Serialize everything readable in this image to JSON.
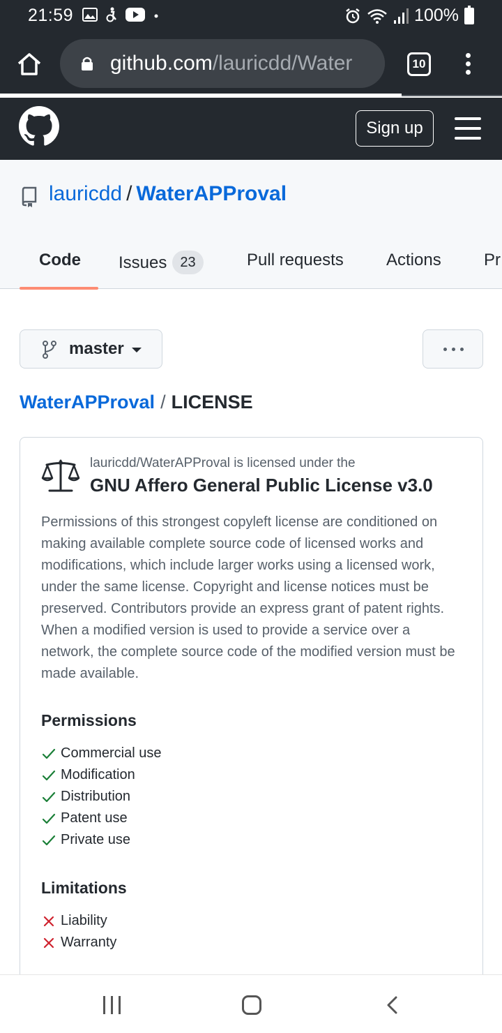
{
  "status_bar": {
    "time": "21:59",
    "battery": "100%",
    "icons": [
      "gallery-icon",
      "accessibility-icon",
      "youtube-icon",
      "dot-icon",
      "alarm-icon",
      "wifi-icon",
      "signal-icon",
      "battery-icon"
    ]
  },
  "browser": {
    "url_host": "github.com",
    "url_path": "/lauricdd/Water",
    "tab_count": "10",
    "load_progress": 0.8
  },
  "header": {
    "sign_up_label": "Sign up"
  },
  "repo": {
    "owner": "lauricdd",
    "separator": "/",
    "name": "WaterAPProval"
  },
  "tabs": [
    {
      "label": "Code",
      "active": true
    },
    {
      "label": "Issues",
      "count": "23"
    },
    {
      "label": "Pull requests"
    },
    {
      "label": "Actions"
    },
    {
      "label": "Pr"
    }
  ],
  "branch": {
    "name": "master"
  },
  "breadcrumb": {
    "repo": "WaterAPProval",
    "separator": "/",
    "file": "LICENSE"
  },
  "license": {
    "intro": "lauricdd/WaterAPProval is licensed under the",
    "name": "GNU Affero General Public License v3.0",
    "description": "Permissions of this strongest copyleft license are conditioned on making available complete source code of licensed works and modifications, which include larger works using a licensed work, under the same license. Copyright and license notices must be preserved. Contributors provide an express grant of patent rights. When a modified version is used to provide a service over a network, the complete source code of the modified version must be made available.",
    "permissions_title": "Permissions",
    "permissions": [
      "Commercial use",
      "Modification",
      "Distribution",
      "Patent use",
      "Private use"
    ],
    "limitations_title": "Limitations",
    "limitations": [
      "Liability",
      "Warranty"
    ]
  },
  "colors": {
    "dark_header": "#24292f",
    "link_blue": "#0969da",
    "tab_underline": "#fd8c73",
    "check_green": "#1a7f37",
    "x_red": "#cf222e"
  }
}
